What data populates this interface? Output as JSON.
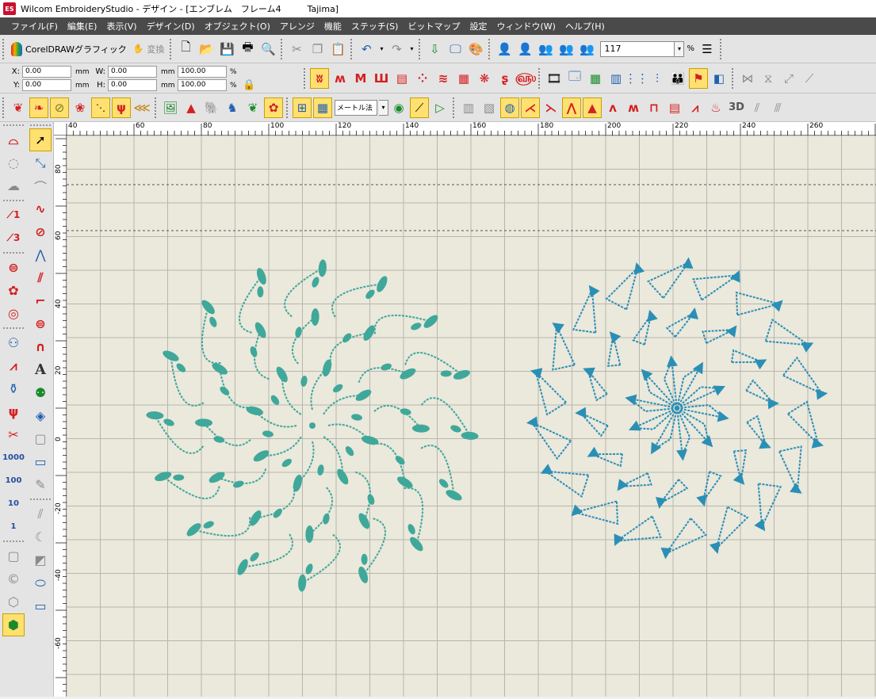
{
  "window": {
    "app_icon": "ES",
    "title": "Wilcom EmbroideryStudio - デザイン - [エンブレム　フレーム4　　　Tajima]"
  },
  "menu": [
    "ファイル(F)",
    "編集(E)",
    "表示(V)",
    "デザイン(D)",
    "オブジェクト(O)",
    "アレンジ",
    "機能",
    "ステッチ(S)",
    "ビットマップ",
    "設定",
    "ウィンドウ(W)",
    "ヘルプ(H)"
  ],
  "toolbar1": {
    "corel_label": "CorelDRAWグラフィック",
    "convert_label": "変換",
    "zoom_value": "117",
    "zoom_unit": "%"
  },
  "coords": {
    "x_label": "X:",
    "x_value": "0.00",
    "x_unit": "mm",
    "y_label": "Y:",
    "y_value": "0.00",
    "y_unit": "mm",
    "w_label": "W:",
    "w_value": "0.00",
    "w_unit": "mm",
    "h_label": "H:",
    "h_value": "0.00",
    "h_unit": "mm",
    "w_pct": "100.00",
    "h_pct": "100.00",
    "pct_symbol": "%"
  },
  "toolbar3": {
    "method": "メートル法",
    "label_3d": "3D"
  },
  "left_tools": {
    "num_1000": "1000",
    "num_100": "100",
    "num_10": "10",
    "num_1": "1",
    "text_tool": "A",
    "label_1": "1",
    "label_3": "3"
  },
  "ruler": {
    "h_labels": [
      "40",
      "60",
      "80",
      "100",
      "120",
      "140",
      "160",
      "180",
      "200",
      "220",
      "240",
      "260"
    ],
    "v_labels": [
      "80",
      "60",
      "40",
      "20",
      "0",
      "-20",
      "-40",
      "-60"
    ]
  },
  "colors": {
    "canvas_bg": "#ebe8dc",
    "grid_line": "#b8b6ad",
    "design_left": "#3fa89a",
    "design_right": "#2a8fb5",
    "menubar_bg": "#4a4a4a",
    "active_tool": "#ffe070"
  }
}
